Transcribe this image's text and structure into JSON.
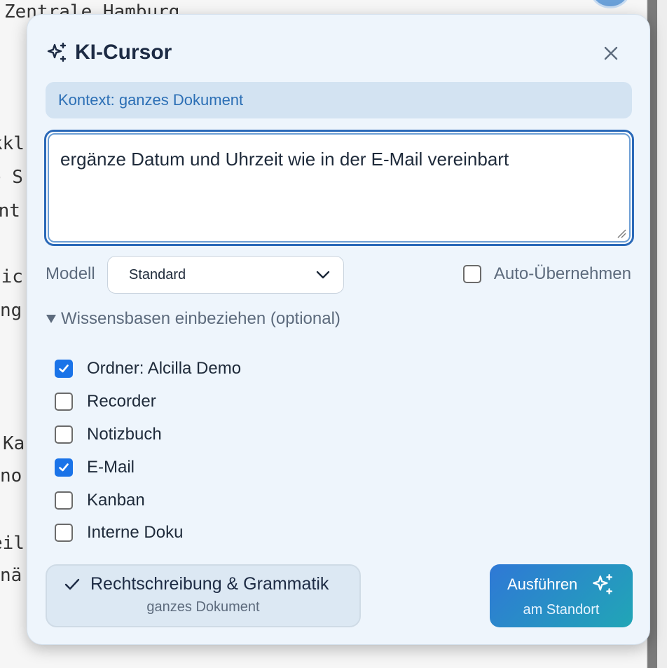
{
  "background_document": {
    "lines": [
      "Zentrale Hamburg",
      "kkl",
      "e S",
      "ent",
      "Sic",
      "ng",
      "Ka",
      "no",
      "eil",
      "nä"
    ]
  },
  "dialog": {
    "title": "KI-Cursor",
    "title_icon": "sparkle-icon",
    "close_icon": "close-icon",
    "context_label": "Kontext: ganzes Dokument",
    "prompt_text": "ergänze Datum und Uhrzeit wie in der E-Mail vereinbart",
    "model": {
      "label": "Modell",
      "selected": "Standard"
    },
    "auto_apply": {
      "label": "Auto-Übernehmen",
      "checked": false
    },
    "knowledge_bases": {
      "toggle_label": "Wissensbasen einbeziehen (optional)",
      "expanded": true,
      "items": [
        {
          "name": "Ordner: Alcilla Demo",
          "checked": true
        },
        {
          "name": "Recorder",
          "checked": false
        },
        {
          "name": "Notizbuch",
          "checked": false
        },
        {
          "name": "E-Mail",
          "checked": true
        },
        {
          "name": "Kanban",
          "checked": false
        },
        {
          "name": "Interne Doku",
          "checked": false
        }
      ]
    },
    "spellcheck_button": {
      "label": "Rechtschreibung & Grammatik",
      "sublabel": "ganzes Dokument"
    },
    "run_button": {
      "label": "Ausführen",
      "sublabel": "am Standort"
    }
  },
  "colors": {
    "accent": "#1a73e8",
    "title": "#1d2b44",
    "context_text": "#2c6fb5",
    "dialog_bg": "#eef5fc",
    "run_gradient_start": "#2f78d6",
    "run_gradient_end": "#21a6b6"
  }
}
